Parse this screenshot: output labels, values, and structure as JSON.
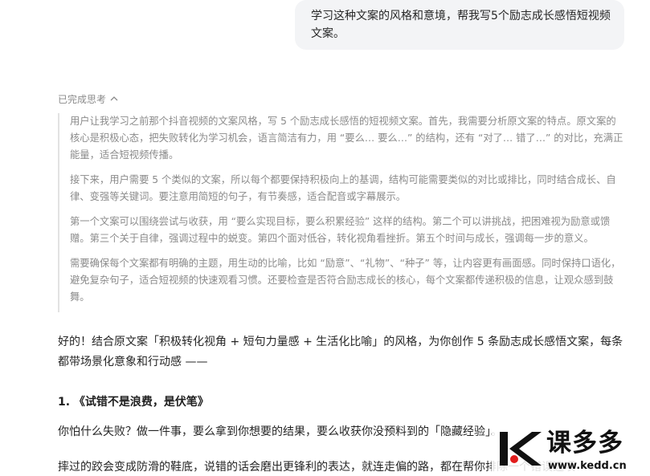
{
  "user_message": {
    "text": "学习这种文案的风格和意境，帮我写5个励志成长感悟短视频文案。"
  },
  "thinking": {
    "label": "已完成思考",
    "toggle_icon": "chevron-up-icon",
    "paragraphs": [
      "用户让我学习之前那个抖音视频的文案风格，写 5 个励志成长感悟的短视频文案。首先，我需要分析原文案的特点。原文案的核心是积极心态，把失败转化为学习机会，语言简洁有力，用 “要么… 要么…” 的结构，还有 “对了… 错了…” 的对比，充满正能量，适合短视频传播。",
      "接下来，用户需要 5 个类似的文案，所以每个都要保持积极向上的基调，结构可能需要类似的对比或排比，同时结合成长、自律、变强等关键词。要注意用简短的句子，有节奏感，适合配音或字幕展示。",
      "第一个文案可以围绕尝试与收获，用 “要么实现目标，要么积累经验” 这样的结构。第二个可以讲挑战，把困难视为励意或馈赠。第三个关于自律，强调过程中的蜕变。第四个面对低谷，转化视角看挫折。第五个时间与成长，强调每一步的意义。",
      "需要确保每个文案都有明确的主题，用生动的比喻，比如 “励意”、“礼物”、“种子” 等，让内容更有画面感。同时保持口语化，避免复杂句子，适合短视频的快速观看习惯。还要检查是否符合励志成长的核心，每个文案都传递积极的信息，让观众感到鼓舞。"
    ]
  },
  "answer": {
    "intro": "好的！结合原文案「积极转化视角 + 短句力量感 + 生活化比喻」的风格，为你创作 5 条励志成长感悟文案，每条都带场景化意象和行动感 ——",
    "section_1_title": "1. 《试错不是浪费，是伏笔》",
    "section_1_para_1": "你怕什么失败？做一件事，要么拿到你想要的结果，要么收获你没预料到的「隐藏经验」。",
    "section_1_para_2": "摔过的跤会变成防滑的鞋底，说错的话会磨出更锋利的表达，就连走偏的路，都在帮你排除一个错误选项"
  },
  "watermark": {
    "name": "课多多",
    "url": "www.kedd.cn",
    "logo_icon": "kedd-logo-icon"
  }
}
